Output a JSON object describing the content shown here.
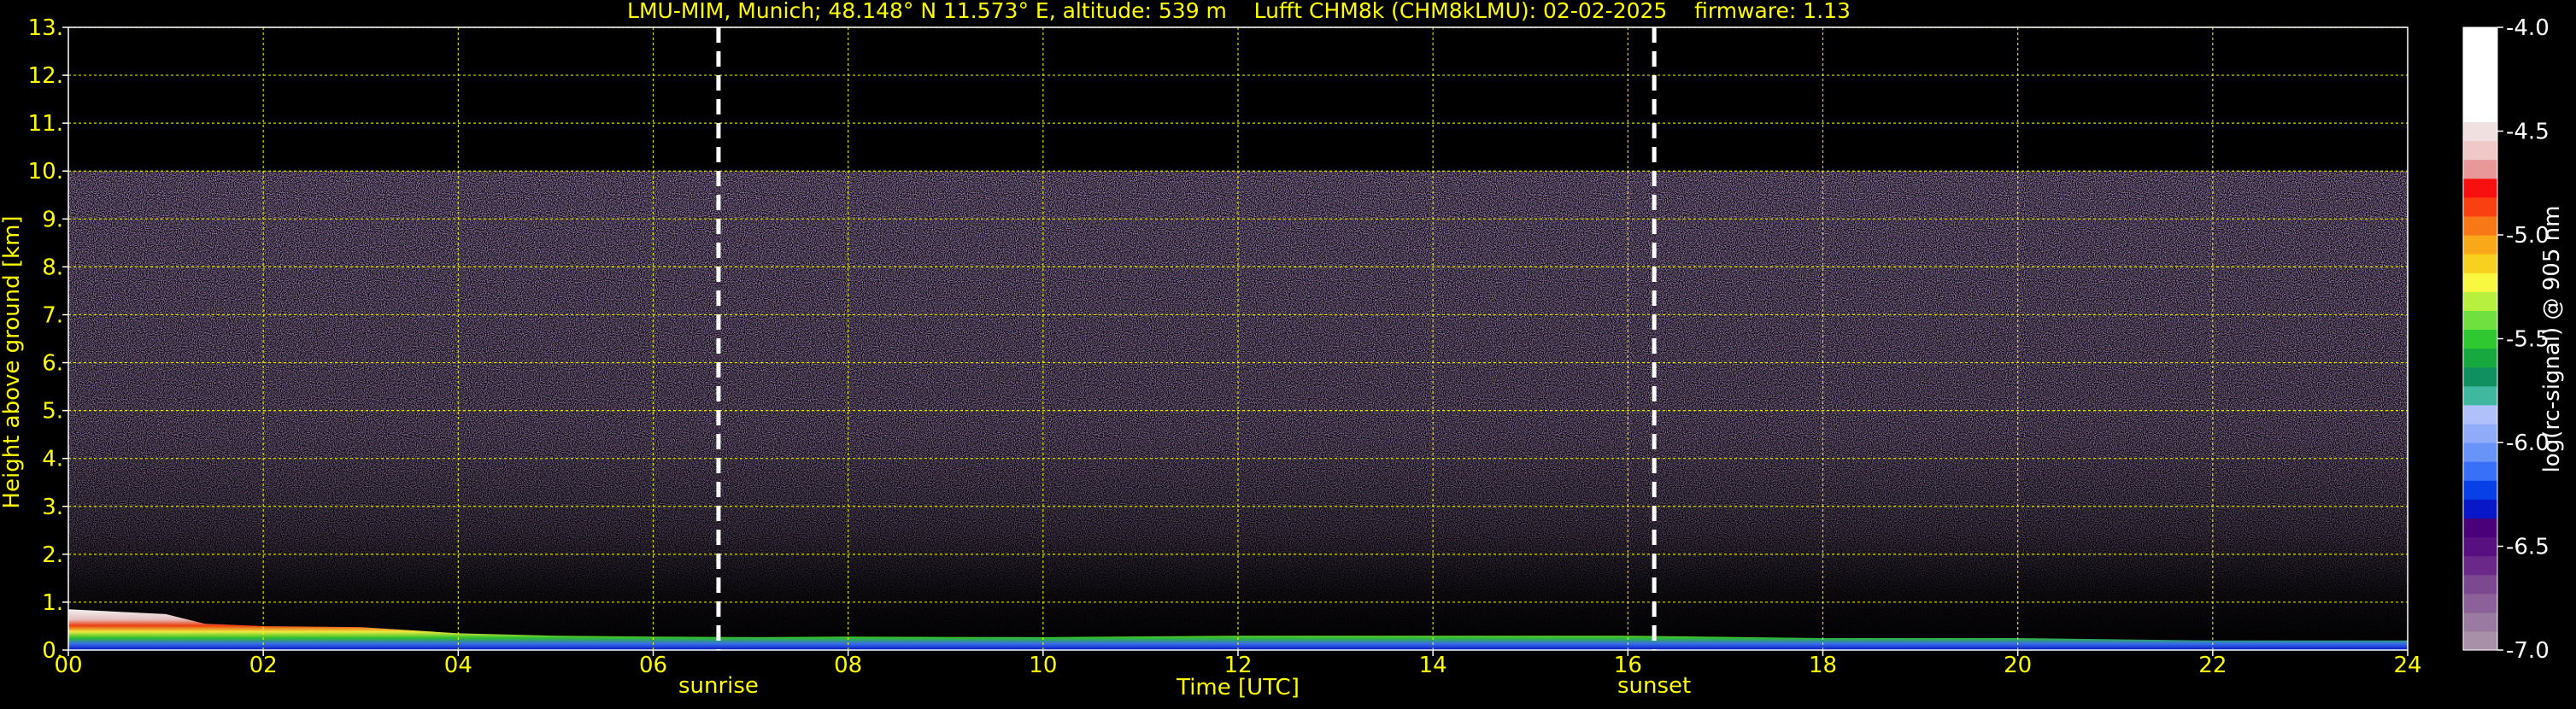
{
  "chart_data": {
    "type": "heatmap",
    "title": "LMU-MIM, Munich; 48.148° N 11.573° E, altitude: 539 m    Lufft CHM8k (CHM8kLMU): 02-02-2025    firmware: 1.13",
    "xlabel": "Time [UTC]",
    "ylabel": "Height above ground [km]",
    "xlim": [
      0,
      24
    ],
    "ylim": [
      0,
      13
    ],
    "x_ticks": [
      "00",
      "02",
      "04",
      "06",
      "08",
      "10",
      "12",
      "14",
      "16",
      "18",
      "20",
      "22",
      "24"
    ],
    "y_ticks": [
      "0.",
      "1.",
      "2.",
      "3.",
      "4.",
      "5.",
      "6.",
      "7.",
      "8.",
      "9.",
      "10.",
      "11.",
      "12.",
      "13."
    ],
    "grid": true,
    "data_top_km": 10,
    "events": [
      {
        "label": "sunrise",
        "hour": 6.67
      },
      {
        "label": "sunset",
        "hour": 16.27
      }
    ],
    "boundary_layer_top_km": [
      [
        0,
        0.85
      ],
      [
        0.5,
        0.8
      ],
      [
        1.0,
        0.75
      ],
      [
        1.4,
        0.55
      ],
      [
        2,
        0.5
      ],
      [
        3,
        0.48
      ],
      [
        4,
        0.35
      ],
      [
        5,
        0.3
      ],
      [
        6,
        0.28
      ],
      [
        7,
        0.27
      ],
      [
        8,
        0.28
      ],
      [
        10,
        0.27
      ],
      [
        12,
        0.3
      ],
      [
        14,
        0.3
      ],
      [
        16,
        0.3
      ],
      [
        18,
        0.25
      ],
      [
        20,
        0.25
      ],
      [
        22,
        0.2
      ],
      [
        24,
        0.2
      ]
    ],
    "colorbar": {
      "label": "log(rc-signal) @ 905 nm",
      "ticks": [
        "-4.0",
        "-4.5",
        "-5.0",
        "-5.5",
        "-6.0",
        "-6.5",
        "-7.0"
      ],
      "min": -7.0,
      "max": -4.0,
      "colors": [
        "#a890a8",
        "#9a7aa0",
        "#8c6098",
        "#7c4890",
        "#6a2888",
        "#581080",
        "#4a0078",
        "#0818c8",
        "#0840e8",
        "#3870f8",
        "#6894f8",
        "#90acf8",
        "#b0c0f8",
        "#40b8a0",
        "#109060",
        "#18a840",
        "#30c830",
        "#70e040",
        "#b8f040",
        "#f8f840",
        "#f8d020",
        "#f8a818",
        "#f87818",
        "#f84010",
        "#f81010",
        "#e89898",
        "#f0c8c8",
        "#f0e0e0",
        "#ffffff",
        "#ffffff",
        "#ffffff",
        "#ffffff",
        "#ffffff"
      ]
    }
  }
}
